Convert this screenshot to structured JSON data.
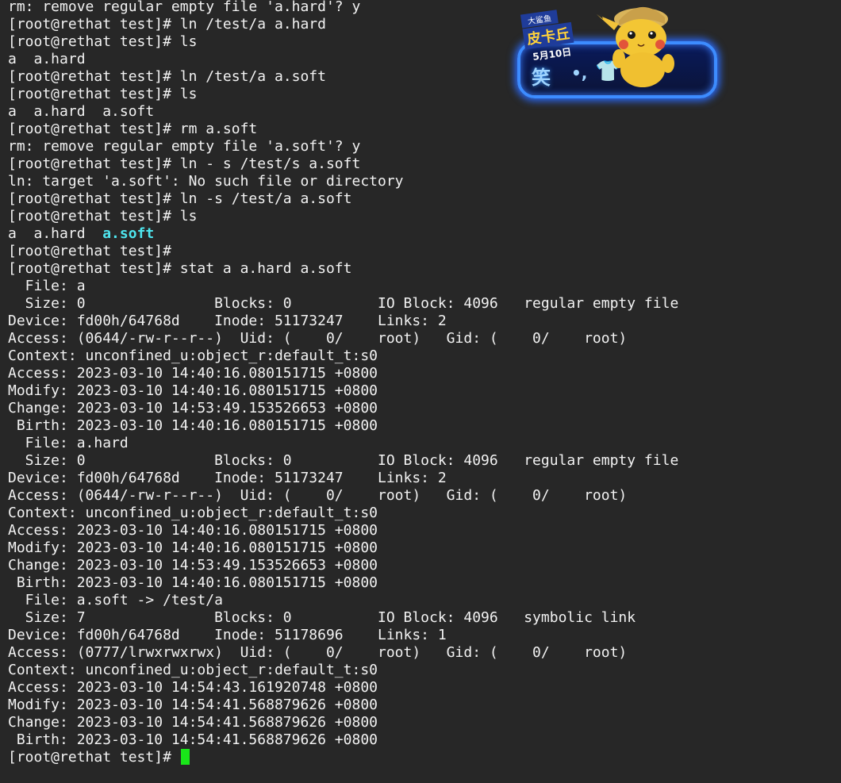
{
  "terminal": {
    "lines": [
      "rm: remove regular empty file 'a.hard'? y",
      "[root@rethat test]# ln /test/a a.hard",
      "[root@rethat test]# ls",
      "a  a.hard",
      "[root@rethat test]# ln /test/a a.soft",
      "[root@rethat test]# ls",
      "a  a.hard  a.soft",
      "[root@rethat test]# rm a.soft",
      "rm: remove regular empty file 'a.soft'? y",
      "[root@rethat test]# ln - s /test/s a.soft",
      "ln: target 'a.soft': No such file or directory",
      "[root@rethat test]# ln -s /test/a a.soft",
      "[root@rethat test]# ls",
      "",
      "[root@rethat test]#",
      "[root@rethat test]# stat a a.hard a.soft",
      "  File: a",
      "  Size: 0               Blocks: 0          IO Block: 4096   regular empty file",
      "Device: fd00h/64768d    Inode: 51173247    Links: 2",
      "Access: (0644/-rw-r--r--)  Uid: (    0/    root)   Gid: (    0/    root)",
      "Context: unconfined_u:object_r:default_t:s0",
      "Access: 2023-03-10 14:40:16.080151715 +0800",
      "Modify: 2023-03-10 14:40:16.080151715 +0800",
      "Change: 2023-03-10 14:53:49.153526653 +0800",
      " Birth: 2023-03-10 14:40:16.080151715 +0800",
      "  File: a.hard",
      "  Size: 0               Blocks: 0          IO Block: 4096   regular empty file",
      "Device: fd00h/64768d    Inode: 51173247    Links: 2",
      "Access: (0644/-rw-r--r--)  Uid: (    0/    root)   Gid: (    0/    root)",
      "Context: unconfined_u:object_r:default_t:s0",
      "Access: 2023-03-10 14:40:16.080151715 +0800",
      "Modify: 2023-03-10 14:40:16.080151715 +0800",
      "Change: 2023-03-10 14:53:49.153526653 +0800",
      " Birth: 2023-03-10 14:40:16.080151715 +0800",
      "  File: a.soft -> /test/a",
      "  Size: 7               Blocks: 0          IO Block: 4096   symbolic link",
      "Device: fd00h/64768d    Inode: 51178696    Links: 1",
      "Access: (0777/lrwxrwxrwx)  Uid: (    0/    root)   Gid: (    0/    root)",
      "Context: unconfined_u:object_r:default_t:s0",
      "Access: 2023-03-10 14:54:43.161920748 +0800",
      "Modify: 2023-03-10 14:54:41.568879626 +0800",
      "Change: 2023-03-10 14:54:41.568879626 +0800",
      " Birth: 2023-03-10 14:54:41.568879626 +0800"
    ],
    "ls_output_colored": {
      "plain": "a  a.hard  ",
      "link": "a.soft"
    },
    "prompt": "[root@rethat test]# ",
    "colors": {
      "background": "#272727",
      "text": "#f2f2f2",
      "symlink": "#4ee6ef",
      "cursor": "#19e619"
    }
  },
  "banner": {
    "tag_top": "大鲨鱼",
    "tag_main": "皮卡丘",
    "date": "5月10日",
    "sign_text": "笑",
    "dots_text": "•,",
    "shirt_icon": "shirt-icon",
    "mascot_icon": "pikachu-icon",
    "frame_color": "#3d8cff"
  }
}
